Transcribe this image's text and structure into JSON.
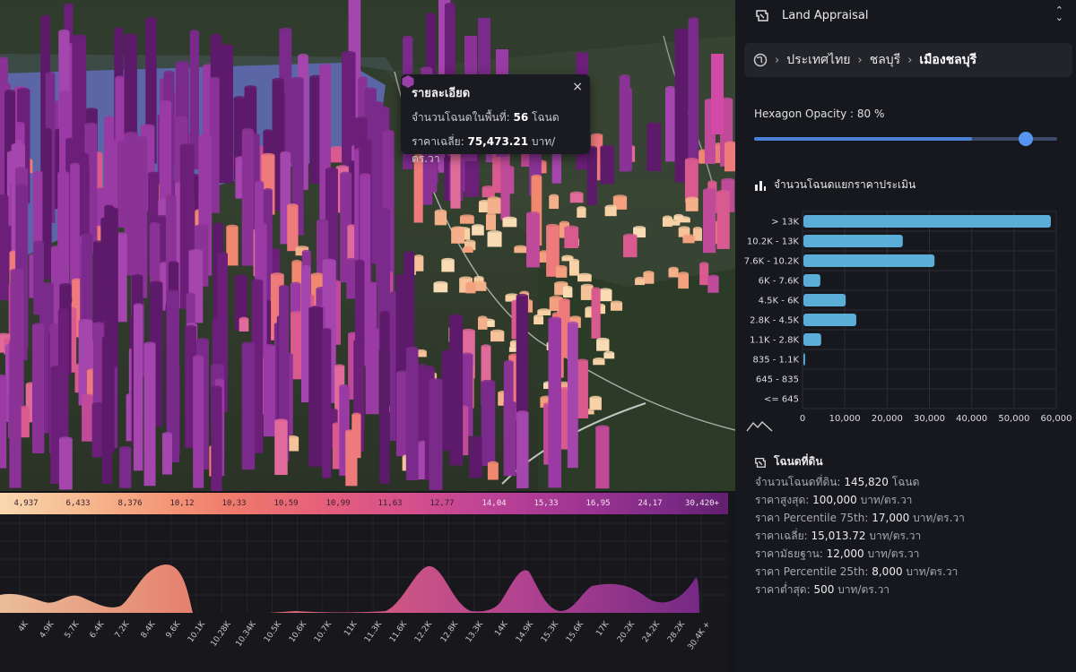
{
  "tooltip": {
    "title": "รายละเอียด",
    "count_label": "จำนวนโฉนดในพื้นที่:",
    "count_value": "56",
    "count_unit": "โฉนด",
    "avg_label": "ราคาเฉลี่ย:",
    "avg_value": "75,473.21",
    "avg_unit": "บาท/ตร.วา",
    "close": "×"
  },
  "legend_ticks": [
    "4,937",
    "6,433",
    "8,376",
    "10,12",
    "10,33",
    "10,59",
    "10,99",
    "11,63",
    "12,77",
    "14,04",
    "15,33",
    "16,95",
    "24,17",
    "30,420+"
  ],
  "dist_ticks": [
    "4K",
    "4.9K",
    "5.7K",
    "6.4K",
    "7.2K",
    "8.4K",
    "9.6K",
    "10.1K",
    "10.28K",
    "10.34K",
    "10.5K",
    "10.6K",
    "10.7K",
    "11K",
    "11.3K",
    "11.6K",
    "12.2K",
    "12.8K",
    "13.3K",
    "14K",
    "14.9K",
    "15.3K",
    "15.6K",
    "17K",
    "20.2K",
    "24.2K",
    "28.2K",
    "30.4K +"
  ],
  "panel": {
    "app_select": "Land Appraisal",
    "breadcrumb": [
      "ประเทศไทย",
      "ชลบุรี",
      "เมืองชลบุรี"
    ],
    "opacity_label": "Hexagon Opacity : 80 %",
    "opacity_value": 80,
    "histogram_title": "จำนวนโฉนดแยกราคาประเมิน",
    "deeds_title": "โฉนดที่ดิน",
    "stats": [
      {
        "label": "จำนวนโฉนดที่ดิน:",
        "value": "145,820",
        "unit": "โฉนด"
      },
      {
        "label": "ราคาสูงสุด:",
        "value": "100,000",
        "unit": "บาท/ตร.วา"
      },
      {
        "label": "ราคา Percentile 75th:",
        "value": "17,000",
        "unit": "บาท/ตร.วา"
      },
      {
        "label": "ราคาเฉลี่ย:",
        "value": "15,013.72",
        "unit": "บาท/ตร.วา"
      },
      {
        "label": "ราคามัธยฐาน:",
        "value": "12,000",
        "unit": "บาท/ตร.วา"
      },
      {
        "label": "ราคา Percentile 25th:",
        "value": "8,000",
        "unit": "บาท/ตร.วา"
      },
      {
        "label": "ราคาต่ำสุด:",
        "value": "500",
        "unit": "บาท/ตร.วา"
      }
    ]
  },
  "chart_data": {
    "type": "bar",
    "orientation": "horizontal",
    "categories": [
      "> 13K",
      "10.2K - 13K",
      "7.6K - 10.2K",
      "6K - 7.6K",
      "4.5K - 6K",
      "2.8K - 4.5K",
      "1.1K - 2.8K",
      "835 - 1.1K",
      "645 - 835",
      "<= 645"
    ],
    "values": [
      58500,
      23500,
      31000,
      4000,
      10000,
      12500,
      4200,
      400,
      0,
      0
    ],
    "xticks": [
      "0",
      "10,000",
      "20,000",
      "30,000",
      "40,000",
      "50,000",
      "60,000"
    ],
    "xlim": [
      0,
      60000
    ],
    "grid": true,
    "bar_color": "#5aaed8"
  },
  "colors": {
    "accent": "#4a82d8",
    "bar": "#5aaed8",
    "hex_purple": "#7a2a8a",
    "hex_pink": "#e06a9a",
    "hex_peach": "#f8cfa0"
  }
}
